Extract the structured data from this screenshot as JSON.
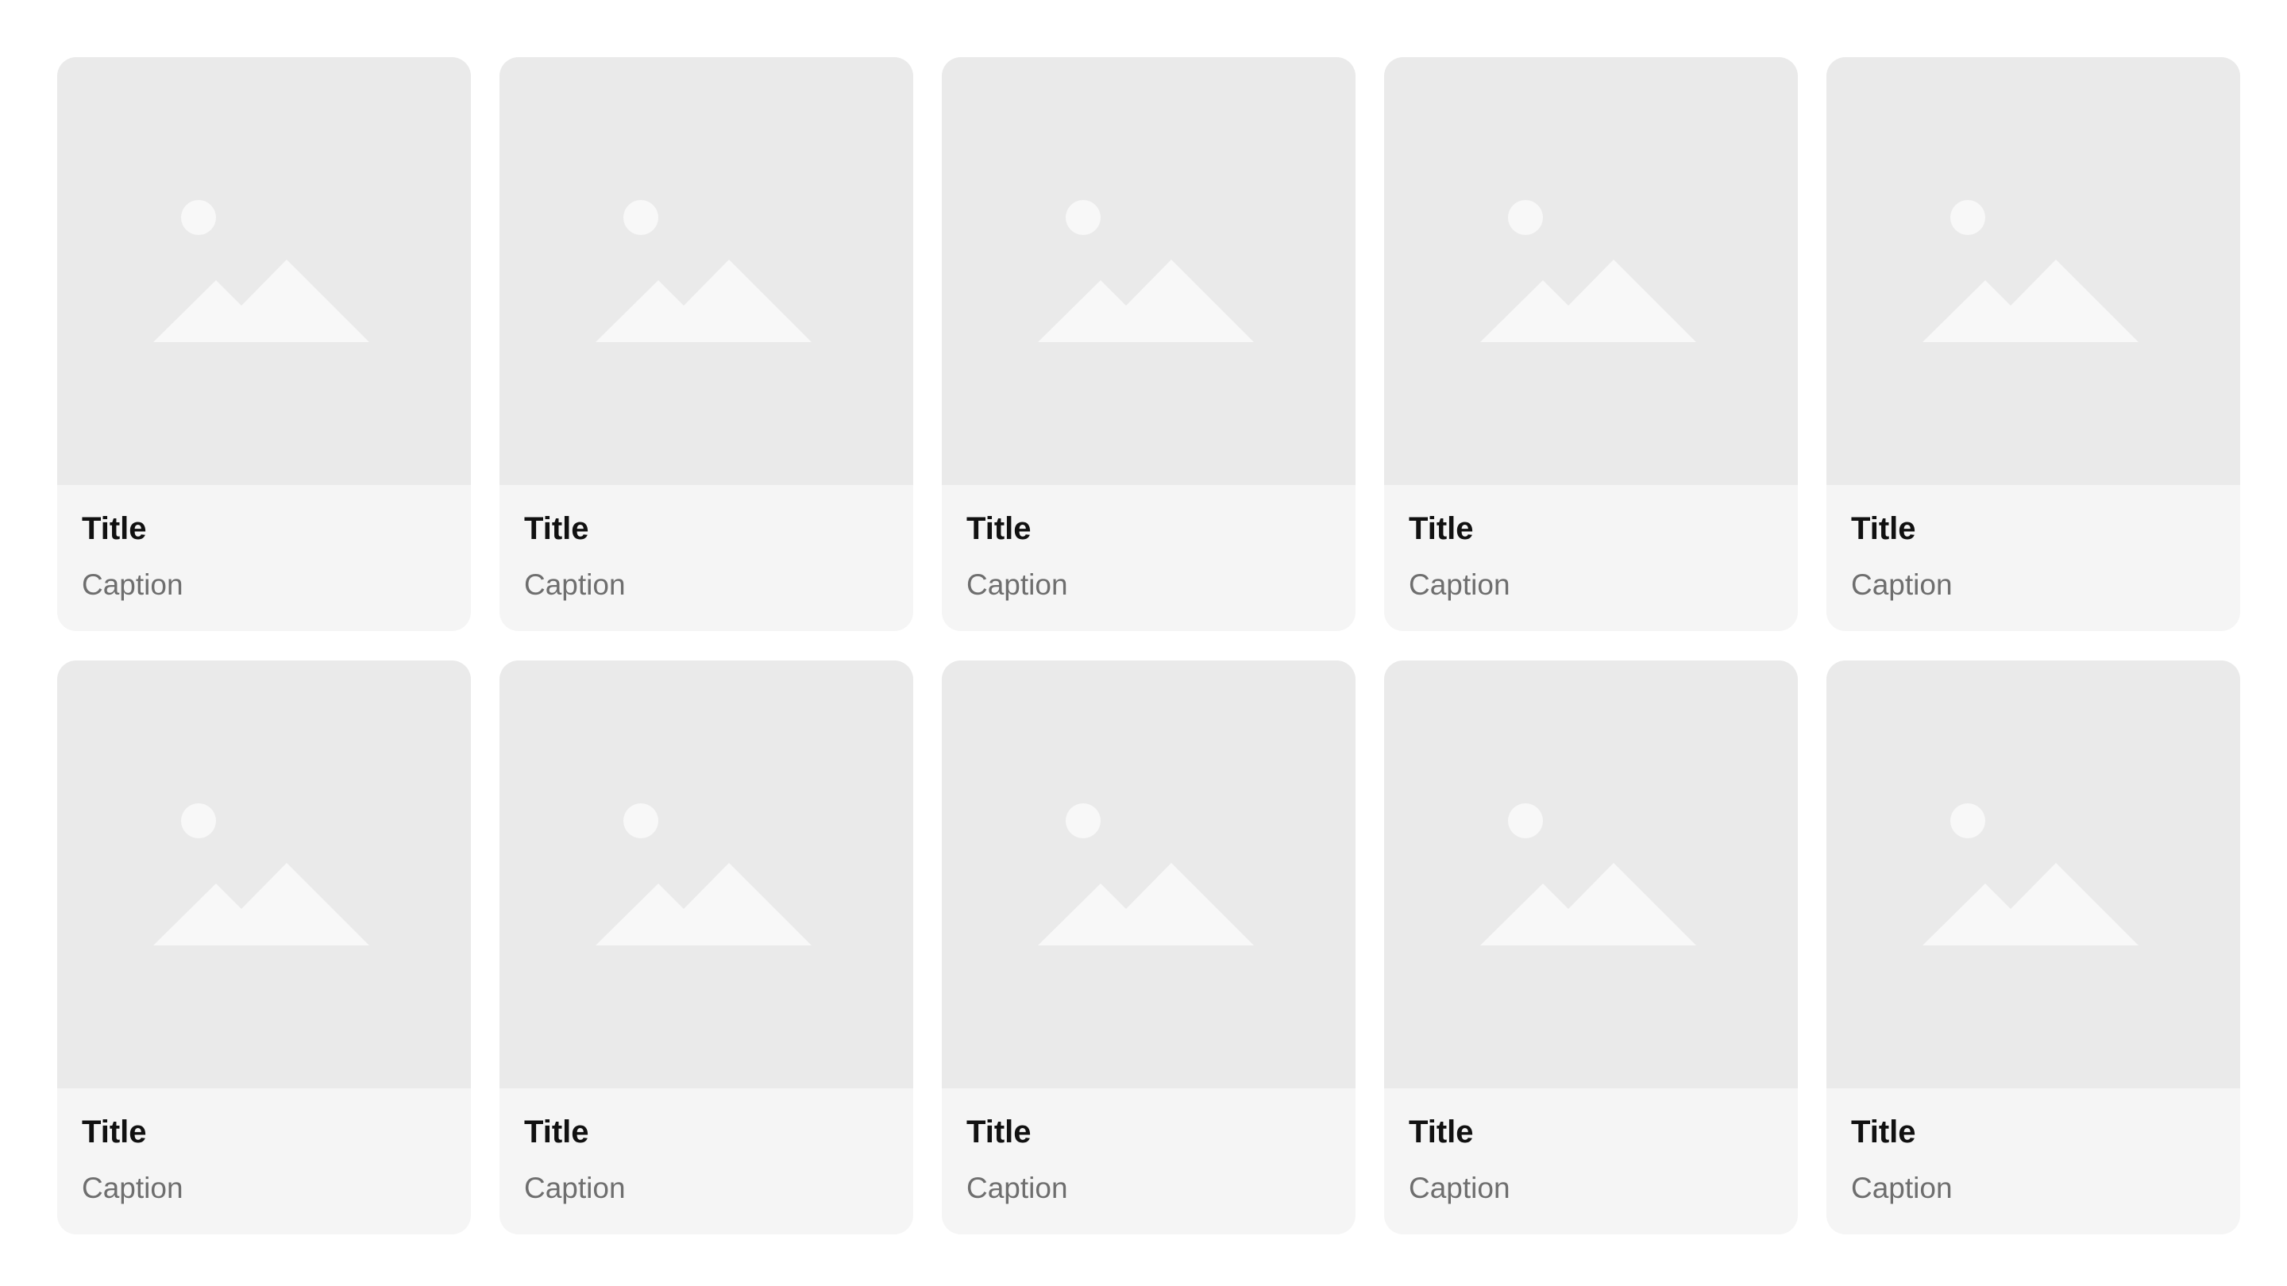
{
  "colors": {
    "page_background": "#ffffff",
    "card_background": "#f5f5f5",
    "image_placeholder_background": "#eaeaea",
    "image_placeholder_glyph": "#f8f8f8",
    "title_text": "#111111",
    "caption_text": "#6e6e6e"
  },
  "gallery": {
    "cards": [
      {
        "title": "Title",
        "caption": "Caption",
        "icon": "image-placeholder-icon"
      },
      {
        "title": "Title",
        "caption": "Caption",
        "icon": "image-placeholder-icon"
      },
      {
        "title": "Title",
        "caption": "Caption",
        "icon": "image-placeholder-icon"
      },
      {
        "title": "Title",
        "caption": "Caption",
        "icon": "image-placeholder-icon"
      },
      {
        "title": "Title",
        "caption": "Caption",
        "icon": "image-placeholder-icon"
      },
      {
        "title": "Title",
        "caption": "Caption",
        "icon": "image-placeholder-icon"
      },
      {
        "title": "Title",
        "caption": "Caption",
        "icon": "image-placeholder-icon"
      },
      {
        "title": "Title",
        "caption": "Caption",
        "icon": "image-placeholder-icon"
      },
      {
        "title": "Title",
        "caption": "Caption",
        "icon": "image-placeholder-icon"
      },
      {
        "title": "Title",
        "caption": "Caption",
        "icon": "image-placeholder-icon"
      }
    ]
  }
}
